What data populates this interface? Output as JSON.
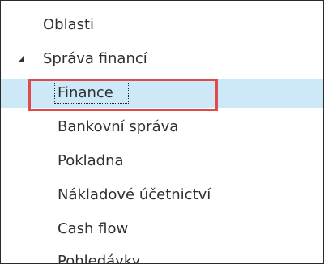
{
  "tree": {
    "root_label": "Oblasti",
    "group": {
      "label": "Správa financí",
      "expanded": true,
      "items": [
        {
          "label": "Finance",
          "selected": true
        },
        {
          "label": "Bankovní správa"
        },
        {
          "label": "Pokladna"
        },
        {
          "label": "Nákladové účetnictví"
        },
        {
          "label": "Cash flow"
        },
        {
          "label": "Pohledávky"
        }
      ]
    }
  },
  "colors": {
    "selection_background": "#cde8f7",
    "highlight_border": "#e04a4a",
    "text": "#303030"
  }
}
